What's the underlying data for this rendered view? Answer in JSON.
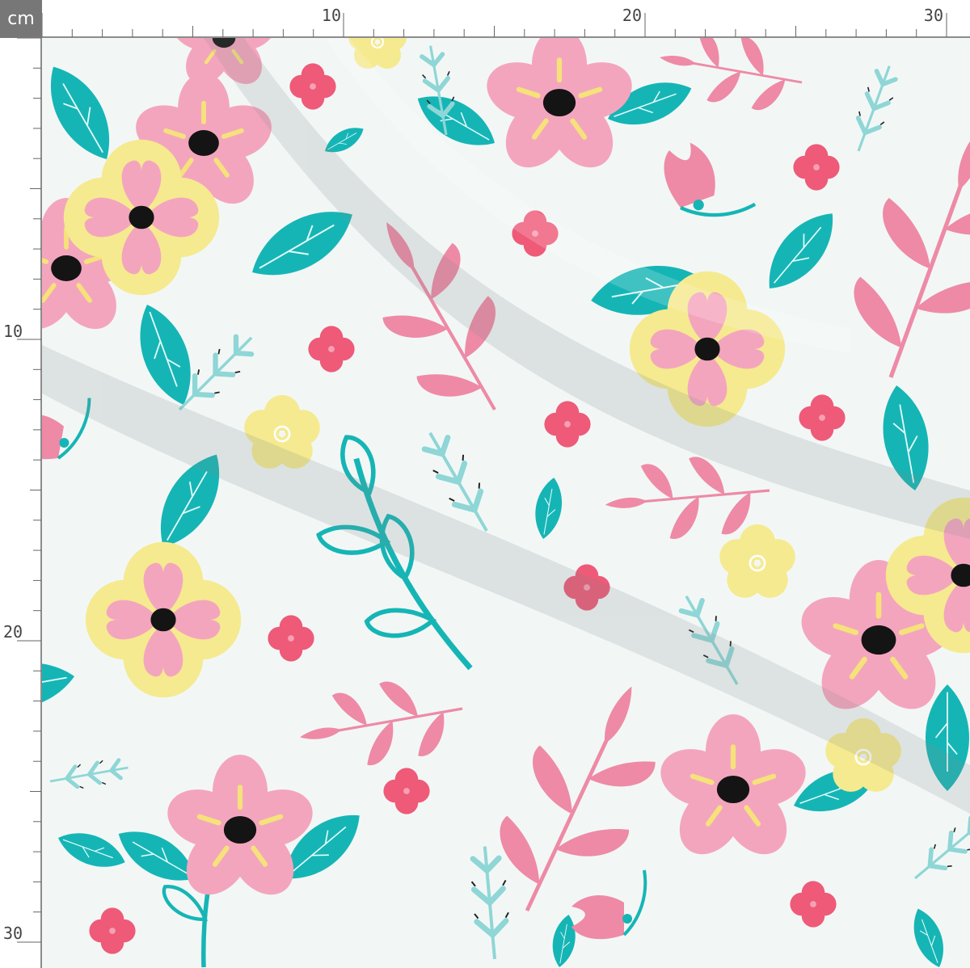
{
  "ruler": {
    "unit": "cm",
    "top_labels": [
      "10",
      "20",
      "30"
    ],
    "left_labels": [
      "10",
      "20",
      "30"
    ]
  },
  "pattern": {
    "motifs": [
      "pink-flower",
      "yellow-flower",
      "small-red-flower",
      "small-yellow-flower",
      "pink-leaf-branch",
      "teal-leaf",
      "teal-outline-branch",
      "mint-sprig",
      "tulip-bud"
    ],
    "colors": {
      "background": "#f2f7f6",
      "teal": "#16b5b5",
      "pink": "#f4a5be",
      "rose": "#ee8aa6",
      "red": "#ee5a78",
      "yellow": "#f5ea8f",
      "mint": "#8fd6d6",
      "center": "#141414"
    }
  }
}
